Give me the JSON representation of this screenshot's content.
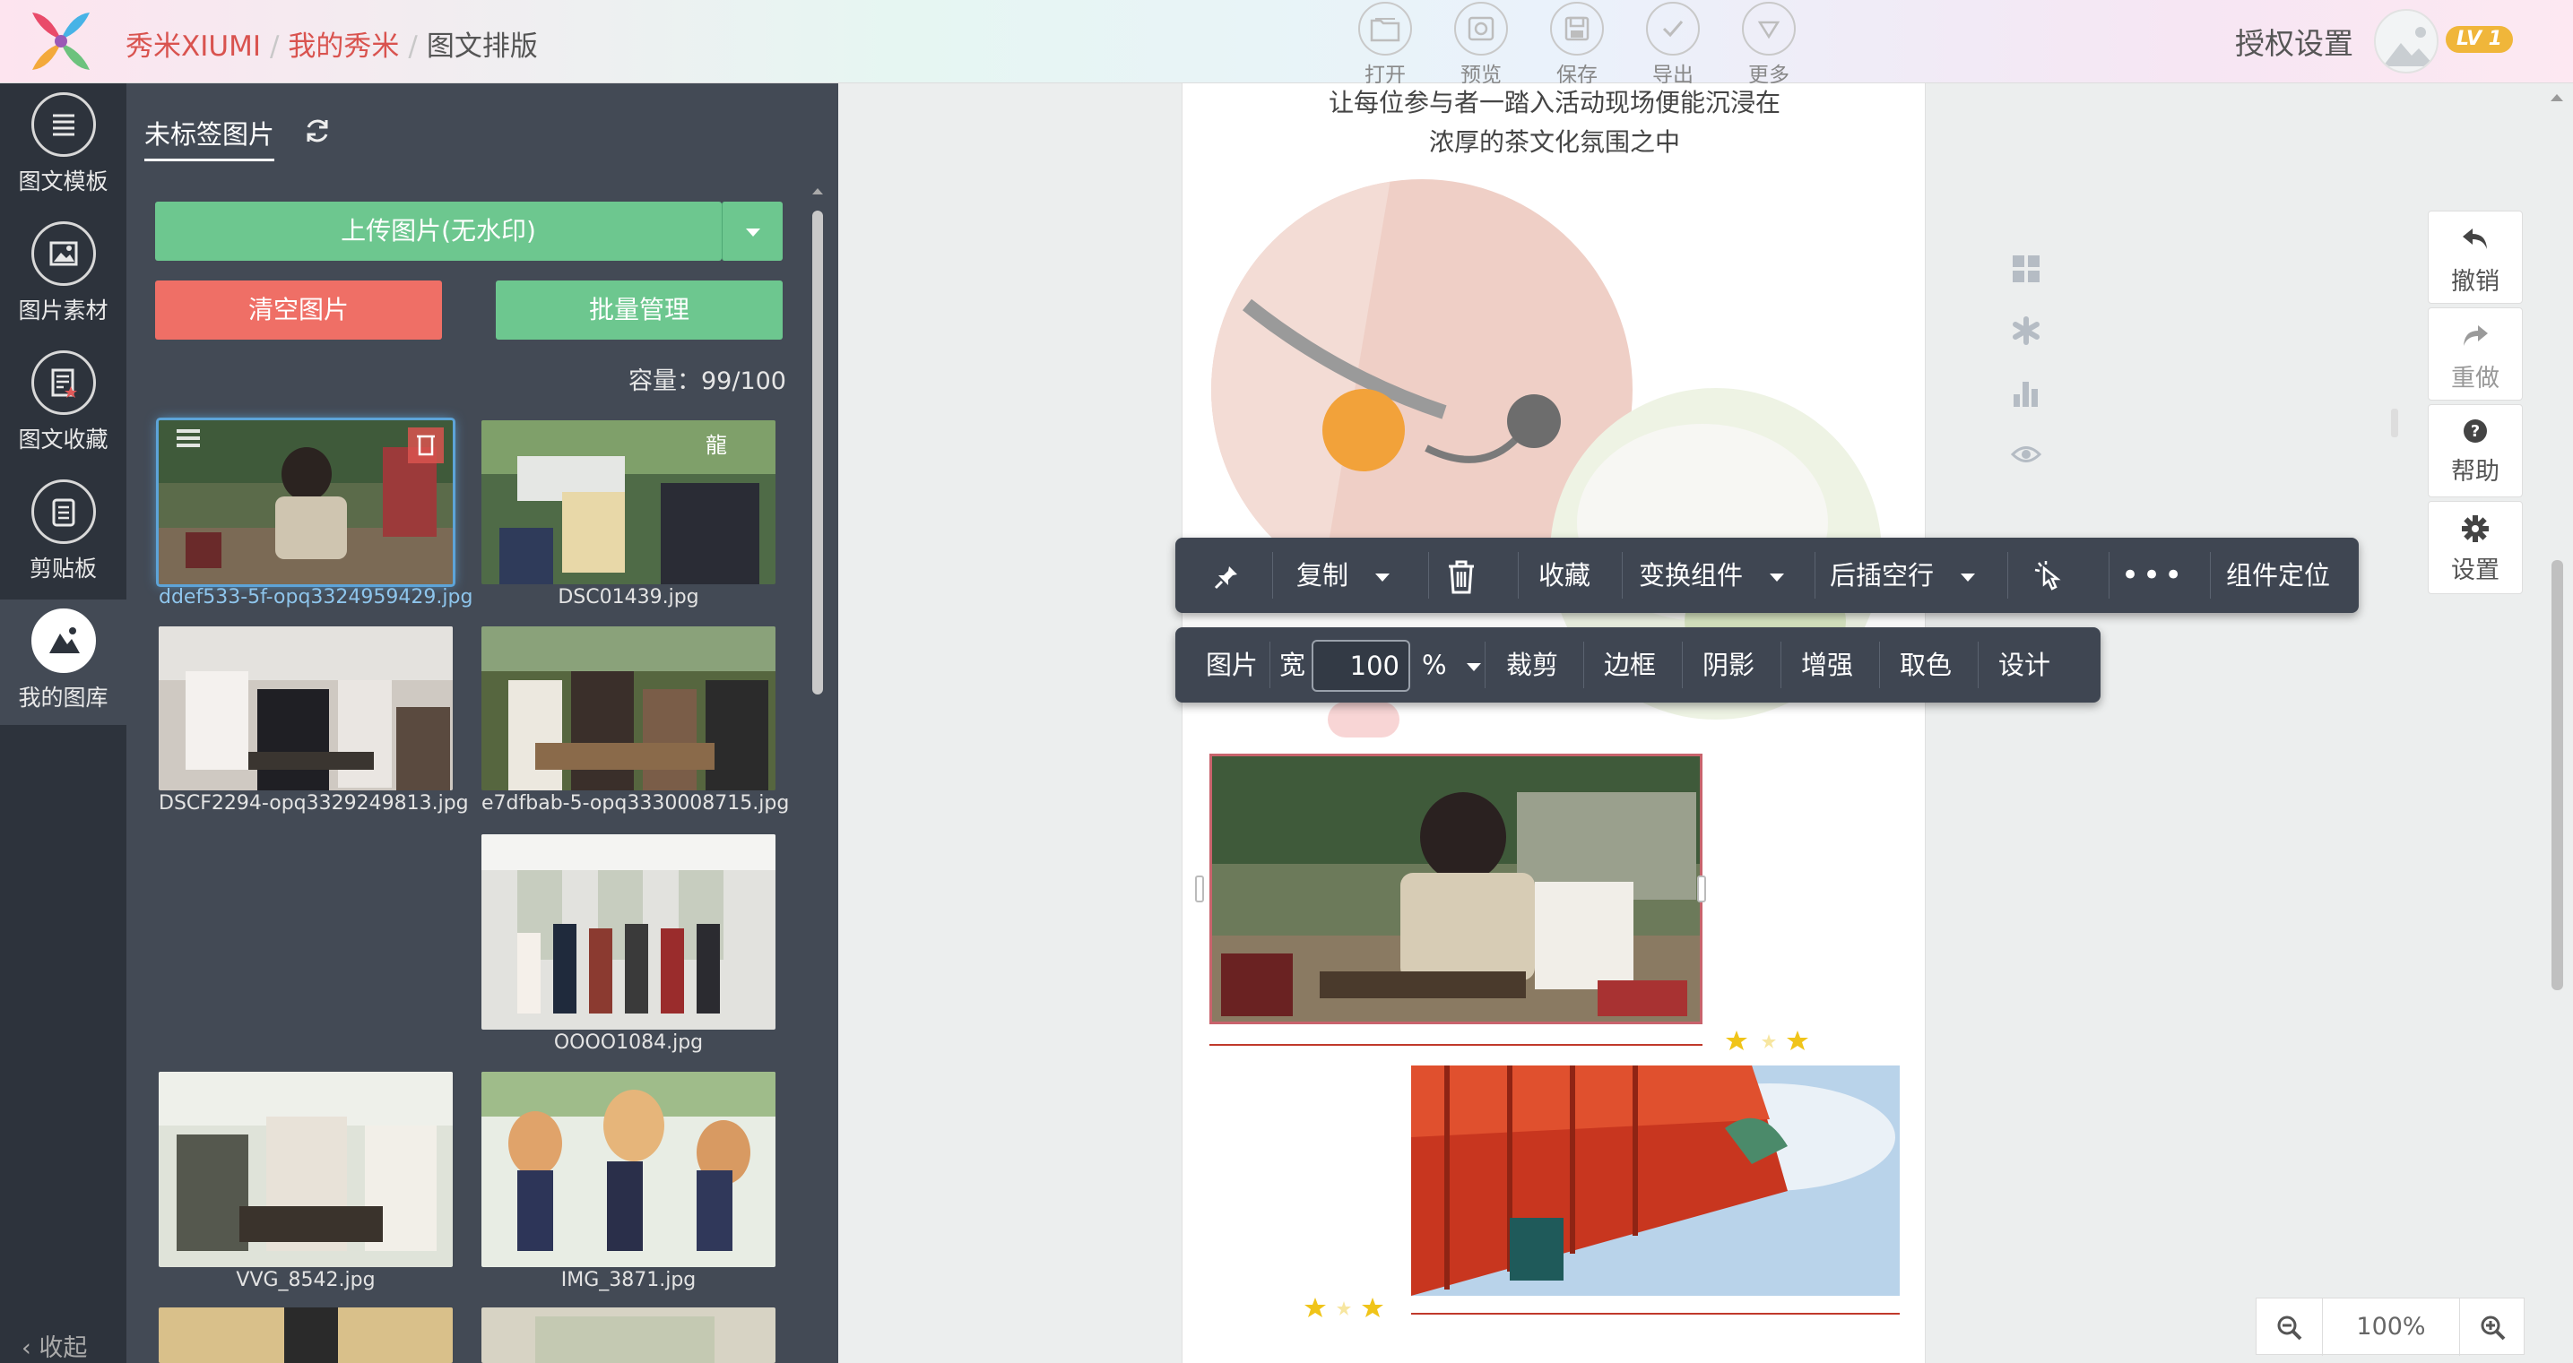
{
  "header": {
    "breadcrumbs": [
      "秀米XIUMI",
      "我的秀米",
      "图文排版"
    ],
    "separator": "/",
    "toolbar": [
      {
        "label": "打开",
        "icon": "folder-icon"
      },
      {
        "label": "预览",
        "icon": "preview-icon"
      },
      {
        "label": "保存",
        "icon": "save-icon"
      },
      {
        "label": "导出",
        "icon": "export-check-icon"
      },
      {
        "label": "更多",
        "icon": "more-chevron-icon"
      }
    ],
    "auth_label": "授权设置",
    "level_badge": "LV 1"
  },
  "nav": {
    "items": [
      {
        "label": "图文模板",
        "icon": "template-icon"
      },
      {
        "label": "图片素材",
        "icon": "image-material-icon"
      },
      {
        "label": "图文收藏",
        "icon": "favorites-icon"
      },
      {
        "label": "剪贴板",
        "icon": "clipboard-icon"
      },
      {
        "label": "我的图库",
        "icon": "my-gallery-icon",
        "active": true
      }
    ],
    "collapse_label": "收起"
  },
  "library": {
    "tab_label": "未标签图片",
    "upload_label": "上传图片(无水印)",
    "clear_label": "清空图片",
    "batch_label": "批量管理",
    "capacity_text": "容量：99/100",
    "thumbs": [
      {
        "name": "ddef533-5f-opq3324959429.jpg",
        "selected": true
      },
      {
        "name": "DSC01439.jpg"
      },
      {
        "name": "DSCF2294-opq3329249813.jpg"
      },
      {
        "name": "e7dfbab-5-opq3330008715.jpg"
      },
      {
        "name": "OOOO1084.jpg"
      },
      {
        "name": "VVG_8542.jpg"
      },
      {
        "name": "IMG_3871.jpg"
      }
    ]
  },
  "canvas": {
    "text_line1": "让每位参与者一踏入活动现场便能沉浸在",
    "text_line2": "浓厚的茶文化氛围之中"
  },
  "component_toolbar": {
    "copy": "复制",
    "favorite": "收藏",
    "transform": "变换组件",
    "insert_after": "后插空行",
    "more": "•••",
    "locate": "组件定位"
  },
  "image_toolbar": {
    "label": "图片",
    "width_label": "宽",
    "width_value": "100",
    "unit": "%",
    "crop": "裁剪",
    "border": "边框",
    "shadow": "阴影",
    "enhance": "增强",
    "pick_color": "取色",
    "design": "设计"
  },
  "right_actions": [
    {
      "label": "撤销",
      "icon": "undo-icon"
    },
    {
      "label": "重做",
      "icon": "redo-icon",
      "disabled": true
    },
    {
      "label": "帮助",
      "icon": "help-icon"
    },
    {
      "label": "设置",
      "icon": "settings-gear-icon"
    }
  ],
  "zoom": {
    "value": "100%"
  },
  "colors": {
    "accent_red": "#d9534f",
    "green_button": "#6dc78f",
    "red_button": "#ef6f66",
    "nav_bg": "#2d333c",
    "panel_bg": "#434a55",
    "badge_yellow": "#f0b63a"
  }
}
